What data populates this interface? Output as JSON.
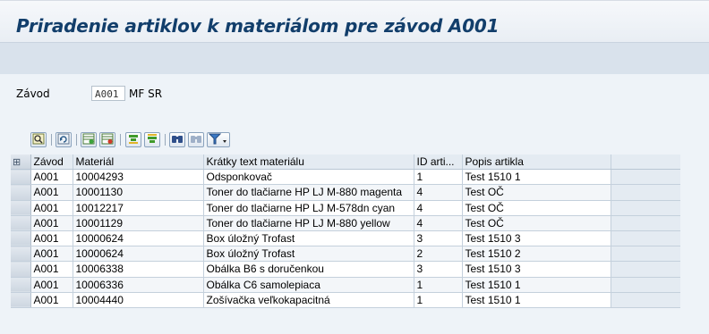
{
  "window": {
    "title": "Priradenie artiklov k materiálom pre závod A001"
  },
  "selection": {
    "plant_label": "Závod",
    "plant_value": "A001",
    "plant_description": "MF SR"
  },
  "toolbar": {
    "icons": [
      "details-icon",
      "refresh-icon",
      "insert-row-icon",
      "delete-row-icon",
      "sort-ascending-icon",
      "sort-descending-icon",
      "find-icon",
      "find-next-icon",
      "filter-icon"
    ]
  },
  "table": {
    "columns": [
      "Závod",
      "Materiál",
      "Krátky text materiálu",
      "ID arti...",
      "Popis artikla"
    ],
    "rows": [
      {
        "plant": "A001",
        "material": "10004293",
        "text": "Odsponkovač",
        "id": "1",
        "desc": "Test 1510 1"
      },
      {
        "plant": "A001",
        "material": "10001130",
        "text": "Toner do tlačiarne HP LJ M-880 magenta",
        "id": "4",
        "desc": "Test OČ"
      },
      {
        "plant": "A001",
        "material": "10012217",
        "text": "Toner do tlačiarne HP LJ M-578dn cyan",
        "id": "4",
        "desc": "Test OČ"
      },
      {
        "plant": "A001",
        "material": "10001129",
        "text": "Toner do tlačiarne HP LJ M-880 yellow",
        "id": "4",
        "desc": "Test OČ"
      },
      {
        "plant": "A001",
        "material": "10000624",
        "text": "Box úložný Trofast",
        "id": "3",
        "desc": "Test 1510 3"
      },
      {
        "plant": "A001",
        "material": "10000624",
        "text": "Box úložný Trofast",
        "id": "2",
        "desc": "Test 1510 2"
      },
      {
        "plant": "A001",
        "material": "10006338",
        "text": "Obálka B6 s doručenkou",
        "id": "3",
        "desc": "Test 1510 3"
      },
      {
        "plant": "A001",
        "material": "10006336",
        "text": "Obálka C6 samolepiaca",
        "id": "1",
        "desc": "Test 1510 1"
      },
      {
        "plant": "A001",
        "material": "10004440",
        "text": "Zošívačka veľkokapacitná",
        "id": "1",
        "desc": "Test 1510 1"
      }
    ]
  }
}
